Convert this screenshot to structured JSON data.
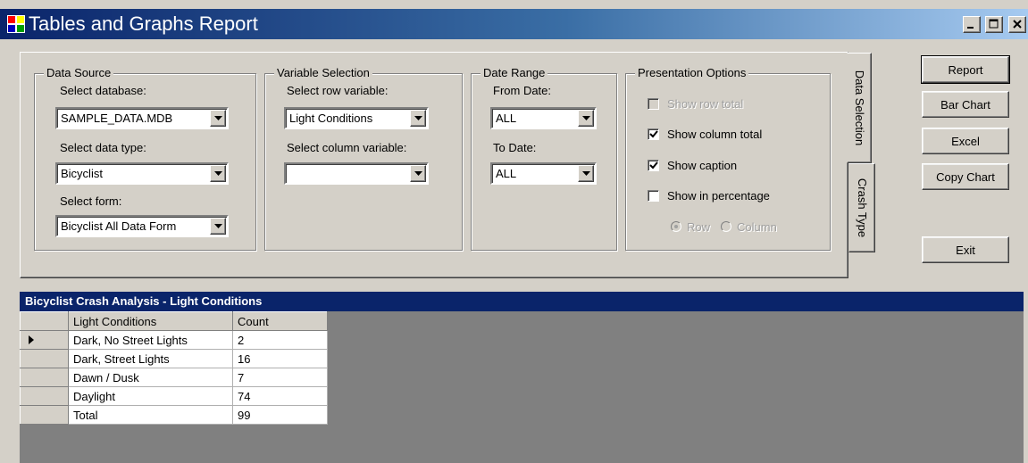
{
  "window": {
    "title": "Tables and Graphs Report",
    "controls": [
      "minimize-icon",
      "maximize-icon",
      "close-icon"
    ]
  },
  "data_source": {
    "group_title": "Data Source",
    "database_label": "Select database:",
    "database_value": "SAMPLE_DATA.MDB",
    "data_type_label": "Select data type:",
    "data_type_value": "Bicyclist",
    "form_label": "Select form:",
    "form_value": "Bicyclist All Data Form"
  },
  "variable_selection": {
    "group_title": "Variable Selection",
    "row_label": "Select row variable:",
    "row_value": "Light Conditions",
    "column_label": "Select column variable:",
    "column_value": ""
  },
  "date_range": {
    "group_title": "Date Range",
    "from_label": "From Date:",
    "from_value": "ALL",
    "to_label": "To Date:",
    "to_value": "ALL"
  },
  "presentation": {
    "group_title": "Presentation Options",
    "show_row_total": {
      "label": "Show row total",
      "checked": false,
      "enabled": false
    },
    "show_column_total": {
      "label": "Show column total",
      "checked": true,
      "enabled": true
    },
    "show_caption": {
      "label": "Show caption",
      "checked": true,
      "enabled": true
    },
    "show_percentage": {
      "label": "Show in percentage",
      "checked": false,
      "enabled": true
    },
    "radio_row": {
      "label": "Row",
      "selected": true
    },
    "radio_column": {
      "label": "Column",
      "selected": false
    }
  },
  "tabs": [
    {
      "label": "Data Selection",
      "active": true
    },
    {
      "label": "Crash Type",
      "active": false
    }
  ],
  "buttons": {
    "report": "Report",
    "bar_chart": "Bar Chart",
    "excel": "Excel",
    "copy_chart": "Copy Chart",
    "exit": "Exit"
  },
  "results": {
    "caption": "Bicyclist Crash Analysis - Light Conditions",
    "columns": [
      "Light Conditions",
      "Count"
    ],
    "rows": [
      {
        "label": "Dark, No Street Lights",
        "count": "2"
      },
      {
        "label": "Dark, Street Lights",
        "count": "16"
      },
      {
        "label": "Dawn / Dusk",
        "count": "7"
      },
      {
        "label": "Daylight",
        "count": "74"
      },
      {
        "label": "Total",
        "count": "99"
      }
    ],
    "current_row": 0
  },
  "colors": {
    "face": "#d4d0c8",
    "title_gradient_start": "#0a246a",
    "title_gradient_end": "#a6caf0",
    "results_background": "#808080",
    "grid_caption": "#0a246a"
  }
}
